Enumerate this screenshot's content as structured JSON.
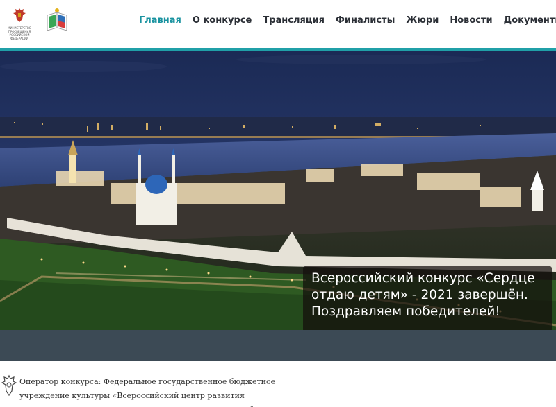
{
  "header": {
    "ministry_logo_text": "МИНИСТЕРСТВО ПРОСВЕЩЕНИЯ РОССИЙСКОЙ ФЕДЕРАЦИИ",
    "nav": [
      {
        "label": "Главная",
        "active": true
      },
      {
        "label": "О конкурсе",
        "active": false
      },
      {
        "label": "Трансляция",
        "active": false
      },
      {
        "label": "Финалисты",
        "active": false
      },
      {
        "label": "Жюри",
        "active": false
      },
      {
        "label": "Новости",
        "active": false
      },
      {
        "label": "Документы",
        "active": false
      }
    ]
  },
  "hero": {
    "caption": "Всероссийский конкурс «Сердце отдаю детям» - 2021 завершён. Поздравляем победителей!"
  },
  "operator": {
    "text": "Оператор конкурса: Федеральное государственное бюджетное учреждение культуры «Всероссийский центр развития художественного творчества и гуманитарных технологий»"
  },
  "colors": {
    "accent": "#1a93a0",
    "accent_bar": "#20a0a8",
    "band": "#3c4a55",
    "nav_text": "#2b2f36"
  }
}
